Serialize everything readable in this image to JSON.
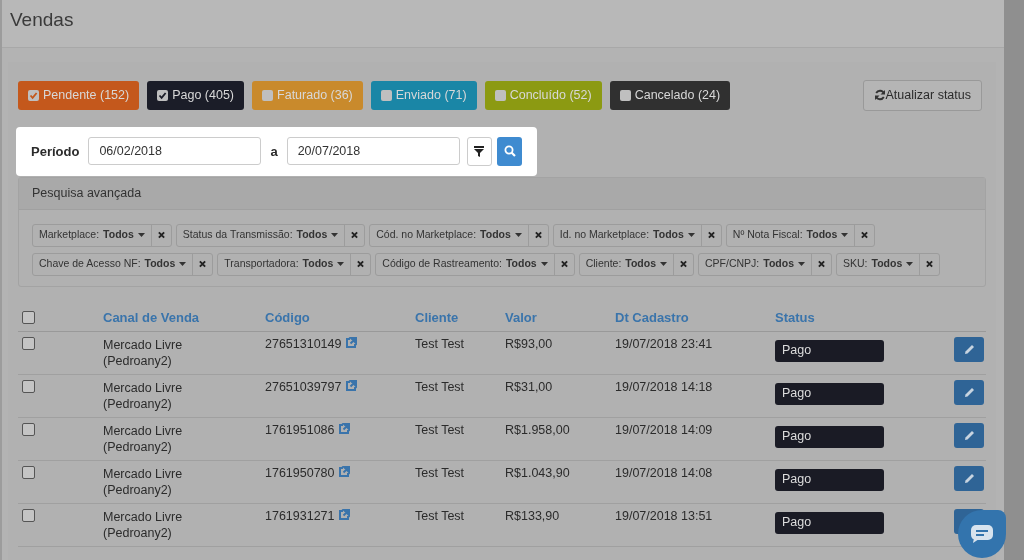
{
  "page_title": "Vendas",
  "status_filters": [
    {
      "label": "Pendente (152)",
      "checked": true,
      "color": "#c4581c"
    },
    {
      "label": "Pago (405)",
      "checked": true,
      "color": "#1b1d28"
    },
    {
      "label": "Faturado (36)",
      "checked": false,
      "color": "#c98a2c"
    },
    {
      "label": "Enviado (71)",
      "checked": false,
      "color": "#1a86a6"
    },
    {
      "label": "Concluído (52)",
      "checked": false,
      "color": "#8c9a12"
    },
    {
      "label": "Cancelado (24)",
      "checked": false,
      "color": "#303030"
    }
  ],
  "refresh_button": "Atualizar status",
  "period": {
    "label": "Período",
    "from": "06/02/2018",
    "separator": "a",
    "to": "20/07/2018"
  },
  "advanced_search": {
    "title": "Pesquisa avançada",
    "filters": [
      {
        "label": "Marketplace:",
        "value": "Todos"
      },
      {
        "label": "Status da Transmissão:",
        "value": "Todos"
      },
      {
        "label": "Cód. no Marketplace:",
        "value": "Todos"
      },
      {
        "label": "Id. no Marketplace:",
        "value": "Todos"
      },
      {
        "label": "Nº Nota Fiscal:",
        "value": "Todos"
      },
      {
        "label": "Chave de Acesso NF:",
        "value": "Todos"
      },
      {
        "label": "Transportadora:",
        "value": "Todos"
      },
      {
        "label": "Código de Rastreamento:",
        "value": "Todos"
      },
      {
        "label": "Cliente:",
        "value": "Todos"
      },
      {
        "label": "CPF/CNPJ:",
        "value": "Todos"
      },
      {
        "label": "SKU:",
        "value": "Todos"
      }
    ]
  },
  "table": {
    "select_all_checked": false,
    "columns": [
      "Canal de Venda",
      "Código",
      "Cliente",
      "Valor",
      "Dt Cadastro",
      "Status"
    ],
    "rows": [
      {
        "checked": false,
        "channel": "Mercado Livre (Pedroany2)",
        "code": "27651310149",
        "client": "Test Test",
        "value": "R$93,00",
        "date": "19/07/2018 23:41",
        "status": "Pago"
      },
      {
        "checked": false,
        "channel": "Mercado Livre (Pedroany2)",
        "code": "27651039797",
        "client": "Test Test",
        "value": "R$31,00",
        "date": "19/07/2018 14:18",
        "status": "Pago"
      },
      {
        "checked": false,
        "channel": "Mercado Livre (Pedroany2)",
        "code": "1761951086",
        "client": "Test Test",
        "value": "R$1.958,00",
        "date": "19/07/2018 14:09",
        "status": "Pago"
      },
      {
        "checked": false,
        "channel": "Mercado Livre (Pedroany2)",
        "code": "1761950780",
        "client": "Test Test",
        "value": "R$1.043,90",
        "date": "19/07/2018 14:08",
        "status": "Pago"
      },
      {
        "checked": false,
        "channel": "Mercado Livre (Pedroany2)",
        "code": "1761931271",
        "client": "Test Test",
        "value": "R$133,90",
        "date": "19/07/2018 13:51",
        "status": "Pago"
      }
    ]
  }
}
